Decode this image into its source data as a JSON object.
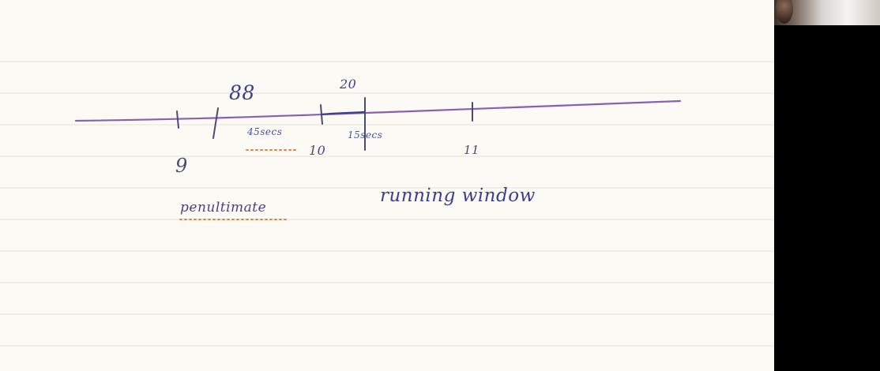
{
  "notes": {
    "label_top_left": "88",
    "label_top_right": "20",
    "duration_left": "45secs",
    "duration_right": "15secs",
    "tick_label_9": "9",
    "tick_label_10": "10",
    "tick_label_11": "11",
    "word_left": "penultimate",
    "word_right": "running window"
  },
  "colors": {
    "paper": "#fbfaf4",
    "rule_line": "#e6e2da",
    "timeline_ink": "#8a5fb0",
    "label_ink": "#3b3e8f",
    "tick_ink": "#4a4a73",
    "underline_dots": "#e2813a",
    "side_panel": "#000000"
  },
  "side_panel": {
    "webcam_visible": true
  }
}
